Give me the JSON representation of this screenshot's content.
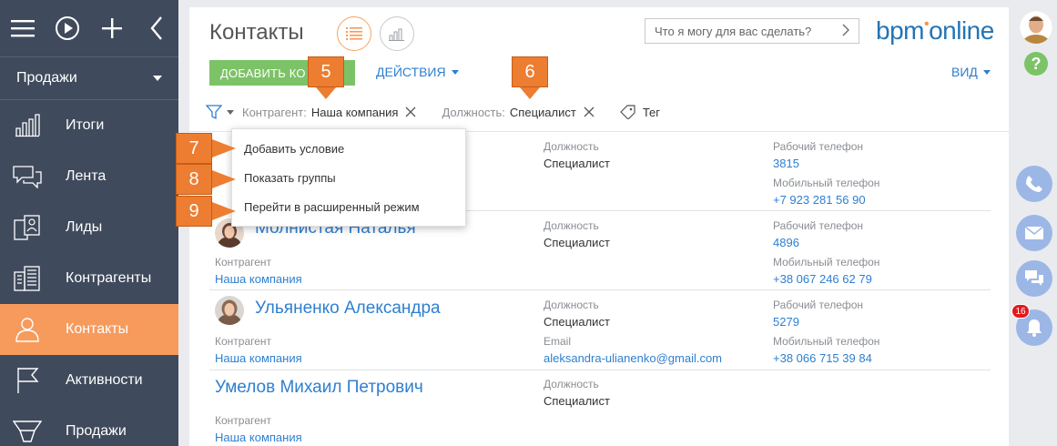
{
  "sidebar": {
    "workplace": "Продажи",
    "items": [
      {
        "label": "Итоги",
        "icon": "chart-bars-icon",
        "active": false
      },
      {
        "label": "Лента",
        "icon": "feed-chat-icon",
        "active": false
      },
      {
        "label": "Лиды",
        "icon": "leads-icon",
        "active": false
      },
      {
        "label": "Контрагенты",
        "icon": "building-icon",
        "active": false
      },
      {
        "label": "Контакты",
        "icon": "person-icon",
        "active": true
      },
      {
        "label": "Активности",
        "icon": "flag-icon",
        "active": false
      },
      {
        "label": "Продажи",
        "icon": "funnel-icon",
        "active": false
      }
    ]
  },
  "header": {
    "title": "Контакты",
    "command_placeholder": "Что я могу для вас сделать?",
    "logo_prefix": "bpm",
    "logo_suffix": "online"
  },
  "toolbar": {
    "add_label": "ДОБАВИТЬ КО",
    "actions_label": "ДЕЙСТВИЯ",
    "view_label": "ВИД"
  },
  "filters": [
    {
      "label": "Контрагент:",
      "value": "Наша компания"
    },
    {
      "label": "Должность:",
      "value": "Специалист"
    }
  ],
  "tag_label": "Тег",
  "dropdown": {
    "items": [
      "Добавить условие",
      "Показать группы",
      "Перейти в расширенный режим"
    ]
  },
  "callouts": [
    "5",
    "6",
    "7",
    "8",
    "9"
  ],
  "records": [
    {
      "name": "",
      "position_label": "Должность",
      "position": "Специалист",
      "work_phone_label": "Рабочий телефон",
      "work_phone": "3815",
      "mobile_label": "Мобильный телефон",
      "mobile": "+7 923 281 56 90"
    },
    {
      "name": "Молнистая Наталья",
      "account_label": "Контрагент",
      "account": "Наша компания",
      "position_label": "Должность",
      "position": "Специалист",
      "work_phone_label": "Рабочий телефон",
      "work_phone": "4896",
      "mobile_label": "Мобильный телефон",
      "mobile": "+38 067 246 62 79"
    },
    {
      "name": "Ульяненко Александра",
      "account_label": "Контрагент",
      "account": "Наша компания",
      "position_label": "Должность",
      "position": "Специалист",
      "email_label": "Email",
      "email": "aleksandra-ulianenko@gmail.com",
      "work_phone_label": "Рабочий телефон",
      "work_phone": "5279",
      "mobile_label": "Мобильный телефон",
      "mobile": "+38 066 715 39 84"
    },
    {
      "name": "Умелов Михаил Петрович",
      "account_label": "Контрагент",
      "account": "Наша компания",
      "position_label": "Должность",
      "position": "Специалист"
    }
  ],
  "notifications_count": "16",
  "colors": {
    "sidebar": "#3f4a5c",
    "active": "#f79b5d",
    "link": "#2e7fd0",
    "add_button": "#7cc367",
    "callout": "#ed7d31"
  }
}
